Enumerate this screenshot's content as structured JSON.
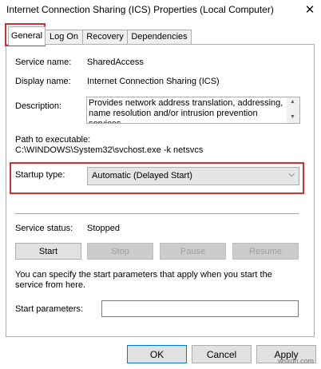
{
  "window": {
    "title": "Internet Connection Sharing (ICS) Properties (Local Computer)",
    "close_glyph": "✕"
  },
  "tabs": [
    {
      "label": "General",
      "active": true
    },
    {
      "label": "Log On",
      "active": false
    },
    {
      "label": "Recovery",
      "active": false
    },
    {
      "label": "Dependencies",
      "active": false
    }
  ],
  "general": {
    "service_name_label": "Service name:",
    "service_name_value": "SharedAccess",
    "display_name_label": "Display name:",
    "display_name_value": "Internet Connection Sharing (ICS)",
    "description_label": "Description:",
    "description_value": "Provides network address translation, addressing, name resolution and/or intrusion prevention services",
    "path_label": "Path to executable:",
    "path_value": "C:\\WINDOWS\\System32\\svchost.exe -k netsvcs",
    "startup_type_label": "Startup type:",
    "startup_type_value": "Automatic (Delayed Start)",
    "service_status_label": "Service status:",
    "service_status_value": "Stopped",
    "start_button": "Start",
    "stop_button": "Stop",
    "pause_button": "Pause",
    "resume_button": "Resume",
    "help_text": "You can specify the start parameters that apply when you start the service from here.",
    "start_params_label": "Start parameters:",
    "start_params_value": ""
  },
  "footer": {
    "ok_button": "OK",
    "cancel_button": "Cancel",
    "apply_button": "Apply"
  },
  "watermark": "wsxdn.com",
  "colors": {
    "highlight_box": "#d32f2f",
    "focus_border": "#0078d7"
  }
}
